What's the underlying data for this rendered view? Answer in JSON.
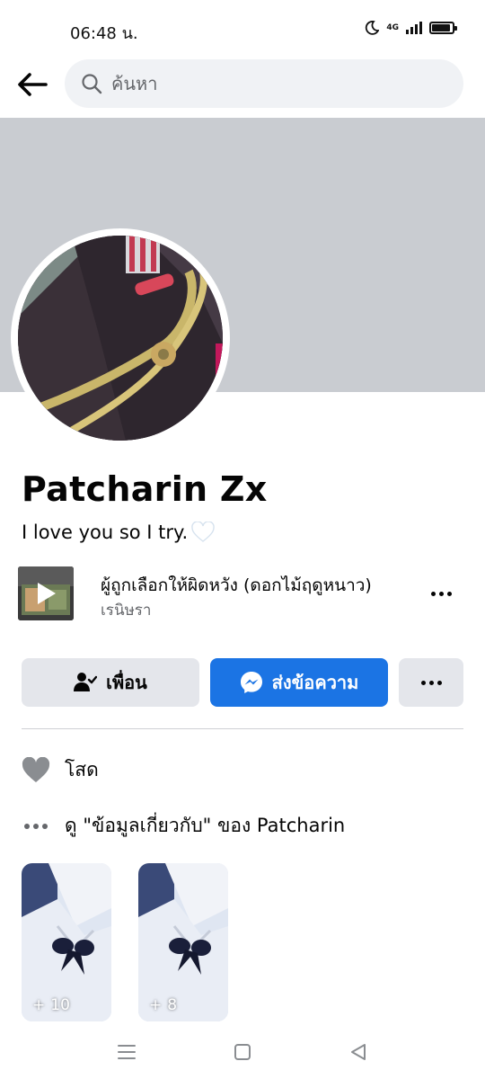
{
  "status_bar": {
    "time": "06:48 น.",
    "network": "4G"
  },
  "search": {
    "placeholder": "ค้นหา"
  },
  "profile": {
    "name": "Patcharin Zx",
    "bio": "I love you so I try."
  },
  "music": {
    "title": "ผู้ถูกเลือกให้ผิดหวัง (ดอกไม้ฤดูหนาว)",
    "artist": "เรนิษรา"
  },
  "actions": {
    "friend_label": "เพื่อน",
    "message_label": "ส่งข้อความ"
  },
  "info": {
    "relationship": "โสด",
    "about": "ดู \"ข้อมูลเกี่ยวกับ\" ของ Patcharin"
  },
  "photos": [
    {
      "count": "10"
    },
    {
      "count": "8"
    }
  ],
  "colors": {
    "accent": "#1b74e4",
    "button_gray": "#e4e6eb",
    "cover": "#c9ccd1",
    "search_bg": "#f0f2f5"
  }
}
